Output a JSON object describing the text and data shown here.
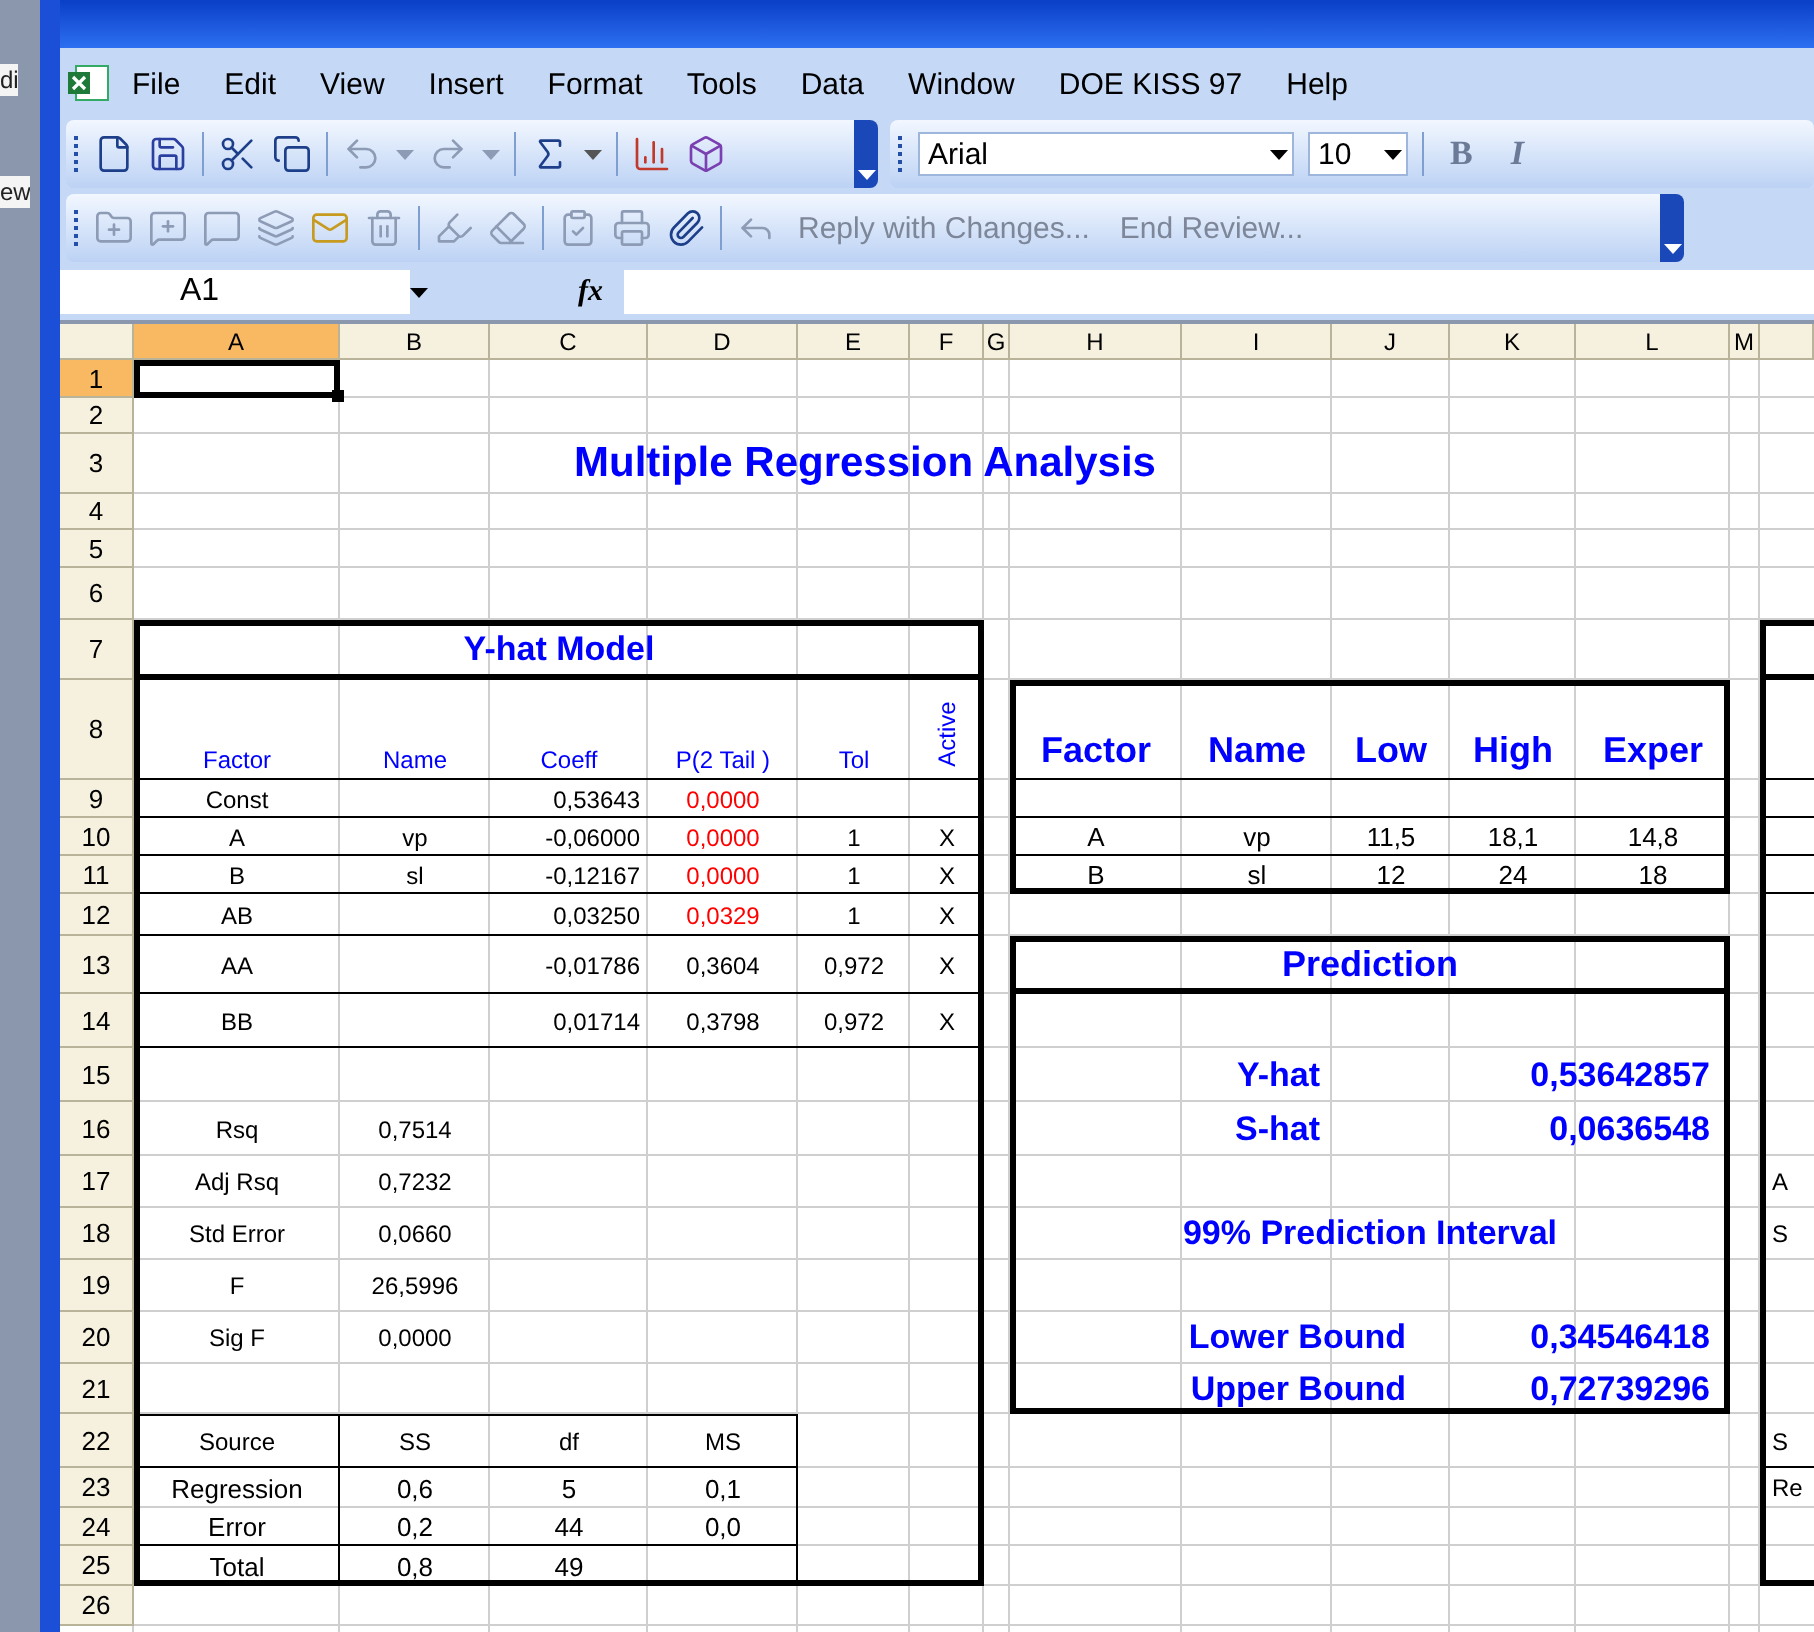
{
  "background_window": {
    "texts": [
      "di",
      "ew"
    ]
  },
  "menu": {
    "items": [
      "File",
      "Edit",
      "View",
      "Insert",
      "Format",
      "Tools",
      "Data",
      "Window",
      "DOE KISS 97",
      "Help"
    ]
  },
  "formatting": {
    "font": "Arial",
    "size": "10",
    "bold_label": "B",
    "italic_label": "I"
  },
  "reviewing": {
    "reply": "Reply with Changes...",
    "end": "End Review..."
  },
  "formula_bar": {
    "name_box": "A1",
    "function_label": "fx"
  },
  "sheet": {
    "columns": [
      {
        "label": "A",
        "selected": true
      },
      {
        "label": "B",
        "selected": false
      },
      {
        "label": "C",
        "selected": false
      },
      {
        "label": "D",
        "selected": false
      },
      {
        "label": "E",
        "selected": false
      },
      {
        "label": "F",
        "selected": false
      },
      {
        "label": "G",
        "selected": false
      },
      {
        "label": "H",
        "selected": false
      },
      {
        "label": "I",
        "selected": false
      },
      {
        "label": "J",
        "selected": false
      },
      {
        "label": "K",
        "selected": false
      },
      {
        "label": "L",
        "selected": false
      },
      {
        "label": "M",
        "selected": false
      }
    ],
    "rows": [
      {
        "label": "1",
        "selected": true
      },
      {
        "label": "2",
        "selected": false
      },
      {
        "label": "3",
        "selected": false
      },
      {
        "label": "4",
        "selected": false
      },
      {
        "label": "5",
        "selected": false
      },
      {
        "label": "6",
        "selected": false
      },
      {
        "label": "7",
        "selected": false
      },
      {
        "label": "8",
        "selected": false
      },
      {
        "label": "9",
        "selected": false
      },
      {
        "label": "10",
        "selected": false
      },
      {
        "label": "11",
        "selected": false
      },
      {
        "label": "12",
        "selected": false
      },
      {
        "label": "13",
        "selected": false
      },
      {
        "label": "14",
        "selected": false
      },
      {
        "label": "15",
        "selected": false
      },
      {
        "label": "16",
        "selected": false
      },
      {
        "label": "17",
        "selected": false
      },
      {
        "label": "18",
        "selected": false
      },
      {
        "label": "19",
        "selected": false
      },
      {
        "label": "20",
        "selected": false
      },
      {
        "label": "21",
        "selected": false
      },
      {
        "label": "22",
        "selected": false
      },
      {
        "label": "23",
        "selected": false
      },
      {
        "label": "24",
        "selected": false
      },
      {
        "label": "25",
        "selected": false
      },
      {
        "label": "26",
        "selected": false
      }
    ]
  },
  "title": "Multiple Regression Analysis",
  "model": {
    "title": "Y-hat Model",
    "columns": [
      "Factor",
      "Name",
      "Coeff",
      "P(2 Tail )",
      "Tol",
      "Active"
    ],
    "rows": [
      {
        "factor": "Const",
        "coeff": "0,53643",
        "p": "0,0000",
        "significant": true
      },
      {
        "factor": "A",
        "name": "vp",
        "coeff": "-0,06000",
        "p": "0,0000",
        "significant": true,
        "tol": "1",
        "active": "X"
      },
      {
        "factor": "B",
        "name": "sl",
        "coeff": "-0,12167",
        "p": "0,0000",
        "significant": true,
        "tol": "1",
        "active": "X"
      },
      {
        "factor": "AB",
        "coeff": "0,03250",
        "p": "0,0329",
        "significant": true,
        "tol": "1",
        "active": "X"
      },
      {
        "factor": "AA",
        "coeff": "-0,01786",
        "p": "0,3604",
        "significant": false,
        "tol": "0,972",
        "active": "X"
      },
      {
        "factor": "BB",
        "coeff": "0,01714",
        "p": "0,3798",
        "significant": false,
        "tol": "0,972",
        "active": "X"
      }
    ]
  },
  "stats": [
    {
      "label": "Rsq",
      "value": "0,7514"
    },
    {
      "label": "Adj Rsq",
      "value": "0,7232"
    },
    {
      "label": "Std Error",
      "value": "0,0660"
    },
    {
      "label": "F",
      "value": "26,5996"
    },
    {
      "label": "Sig F",
      "value": "0,0000"
    }
  ],
  "anova": {
    "columns": [
      "Source",
      "SS",
      "df",
      "MS"
    ],
    "rows": [
      [
        "Regression",
        "0,6",
        "5",
        "0,1"
      ],
      [
        "Error",
        "0,2",
        "44",
        "0,0"
      ],
      [
        "Total",
        "0,8",
        "49"
      ]
    ]
  },
  "factors": {
    "columns": [
      "Factor",
      "Name",
      "Low",
      "High",
      "Exper"
    ],
    "rows": [
      [
        "A",
        "vp",
        "11,5",
        "18,1",
        "14,8"
      ],
      [
        "B",
        "sl",
        "12",
        "24",
        "18"
      ]
    ]
  },
  "prediction": {
    "title": "Prediction",
    "estimates": [
      {
        "label": "Y-hat",
        "value": "0,53642857"
      },
      {
        "label": "S-hat",
        "value": "0,0636548"
      }
    ],
    "interval_title": "99% Prediction Interval",
    "bounds": [
      {
        "label": "Lower Bound",
        "value": "0,34546418"
      },
      {
        "label": "Upper Bound",
        "value": "0,72739296"
      }
    ]
  },
  "right_panel": {
    "fragments": [
      "A",
      "S",
      "S",
      "Re"
    ]
  }
}
